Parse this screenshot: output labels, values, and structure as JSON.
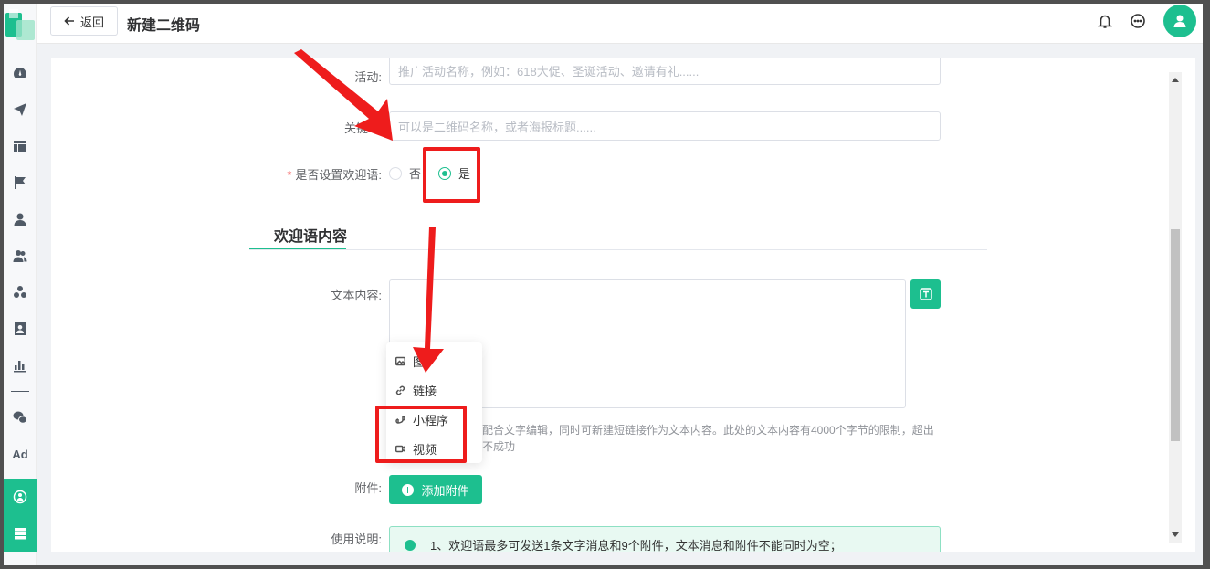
{
  "header": {
    "back_label": "返回",
    "title": "新建二维码"
  },
  "sidebar": {
    "items": [
      {
        "icon": "dashboard-icon"
      },
      {
        "icon": "send-icon"
      },
      {
        "icon": "layout-icon"
      },
      {
        "icon": "flag-icon"
      },
      {
        "icon": "user-icon"
      },
      {
        "icon": "users-icon"
      },
      {
        "icon": "group-icon"
      },
      {
        "icon": "contact-card-icon"
      },
      {
        "icon": "bar-chart-icon"
      },
      {
        "icon": "wechat-icon"
      },
      {
        "icon": "ad-icon",
        "text": "Ad"
      },
      {
        "icon": "qrcode-activity-icon",
        "active": true
      },
      {
        "icon": "server-icon"
      }
    ]
  },
  "form": {
    "activity": {
      "label": "活动:",
      "placeholder": "推广活动名称，例如：618大促、圣诞活动、邀请有礼......"
    },
    "keyword": {
      "label": "关键",
      "placeholder": "可以是二维码名称，或者海报标题......"
    },
    "welcome_toggle": {
      "required_mark": "*",
      "label": "是否设置欢迎语:",
      "options": [
        "否",
        "是"
      ],
      "selected": "是"
    },
    "section_title": "欢迎语内容",
    "text_content": {
      "label": "文本内容:"
    },
    "hint_line1": "配合文字编辑，同时可新建短链接作为文本内容。此处的文本内容有4000个字节的限制，超出",
    "hint_line2": "不成功",
    "attachment_menu": {
      "items": [
        {
          "icon": "image-icon",
          "label": "图"
        },
        {
          "icon": "link-icon",
          "label": "链接"
        },
        {
          "icon": "miniprogram-icon",
          "label": "小程序"
        },
        {
          "icon": "video-icon",
          "label": "视频"
        }
      ]
    },
    "attachment": {
      "label": "附件:",
      "add_label": "添加附件"
    },
    "usage": {
      "label": "使用说明:",
      "notice": "1、欢迎语最多可发送1条文字消息和9个附件，文本消息和附件不能同时为空；"
    }
  },
  "colors": {
    "accent": "#1dbf8f",
    "annotation": "#ee1c1c"
  }
}
